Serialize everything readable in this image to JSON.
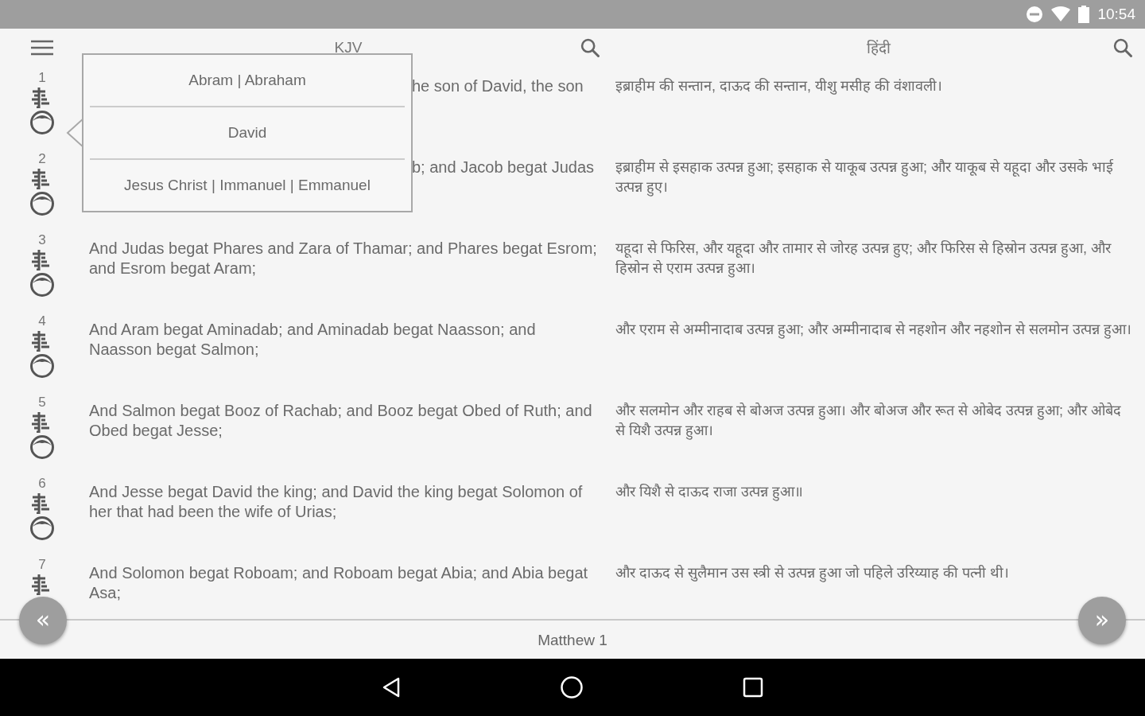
{
  "status_bar": {
    "time": "10:54"
  },
  "header": {
    "columns": [
      {
        "title": "KJV"
      },
      {
        "title": "हिंदी"
      }
    ]
  },
  "popup": {
    "items": [
      "Abram | Abraham",
      "David",
      "Jesus Christ | Immanuel | Emmanuel"
    ]
  },
  "verses": [
    {
      "number": "1",
      "covered": true,
      "kjv": "he son of David, the son",
      "hindi": "इब्राहीम की सन्तान, दाऊद की सन्तान, यीशु मसीह की वंशावली।"
    },
    {
      "number": "2",
      "covered": true,
      "kjv": "b; and Jacob begat Judas",
      "hindi": "इब्राहीम से इसहाक उत्पन्न हुआ; इसहाक से याकूब उत्पन्न हुआ; और याकूब से यहूदा और उसके भाई उत्पन्न हुए।"
    },
    {
      "number": "3",
      "covered": false,
      "kjv": "And Judas begat Phares and Zara of Thamar; and Phares begat Esrom; and Esrom begat Aram;",
      "hindi": "यहूदा से फिरिस, और यहूदा और तामार से जोरह उत्पन्न हुए; और फिरिस से हिस्रोन उत्पन्न हुआ, और हिस्रोन से एराम उत्पन्न हुआ।"
    },
    {
      "number": "4",
      "covered": false,
      "kjv": "And Aram begat Aminadab; and Aminadab begat Naasson; and Naasson begat Salmon;",
      "hindi": "और एराम से अम्मीनादाब उत्पन्न हुआ; और अम्मीनादाब से नहशोन और नहशोन से सलमोन उत्पन्न हुआ।"
    },
    {
      "number": "5",
      "covered": false,
      "kjv": "And Salmon begat Booz of Rachab; and Booz begat Obed of Ruth; and Obed begat Jesse;",
      "hindi": "और सलमोन और राहब से बोअज उत्पन्न हुआ। और बोअज और रूत से ओबेद उत्पन्न हुआ; और ओबेद से यिशै उत्पन्न हुआ।"
    },
    {
      "number": "6",
      "covered": false,
      "kjv": "And Jesse begat David the king; and David the king begat Solomon of her that had been the wife of Urias;",
      "hindi": "और यिशै से दाऊद राजा उत्पन्न हुआ॥"
    },
    {
      "number": "7",
      "covered": false,
      "person_icon": false,
      "kjv": "And Solomon begat Roboam; and Roboam begat Abia; and Abia begat Asa;",
      "hindi": "और दाऊद से सुलैमान उस स्त्री से उत्पन्न हुआ जो पहिले उरिय्याह की पत्नी थी।"
    }
  ],
  "footer": {
    "prev": "«",
    "chapter": "Matthew 1",
    "next": "»"
  }
}
